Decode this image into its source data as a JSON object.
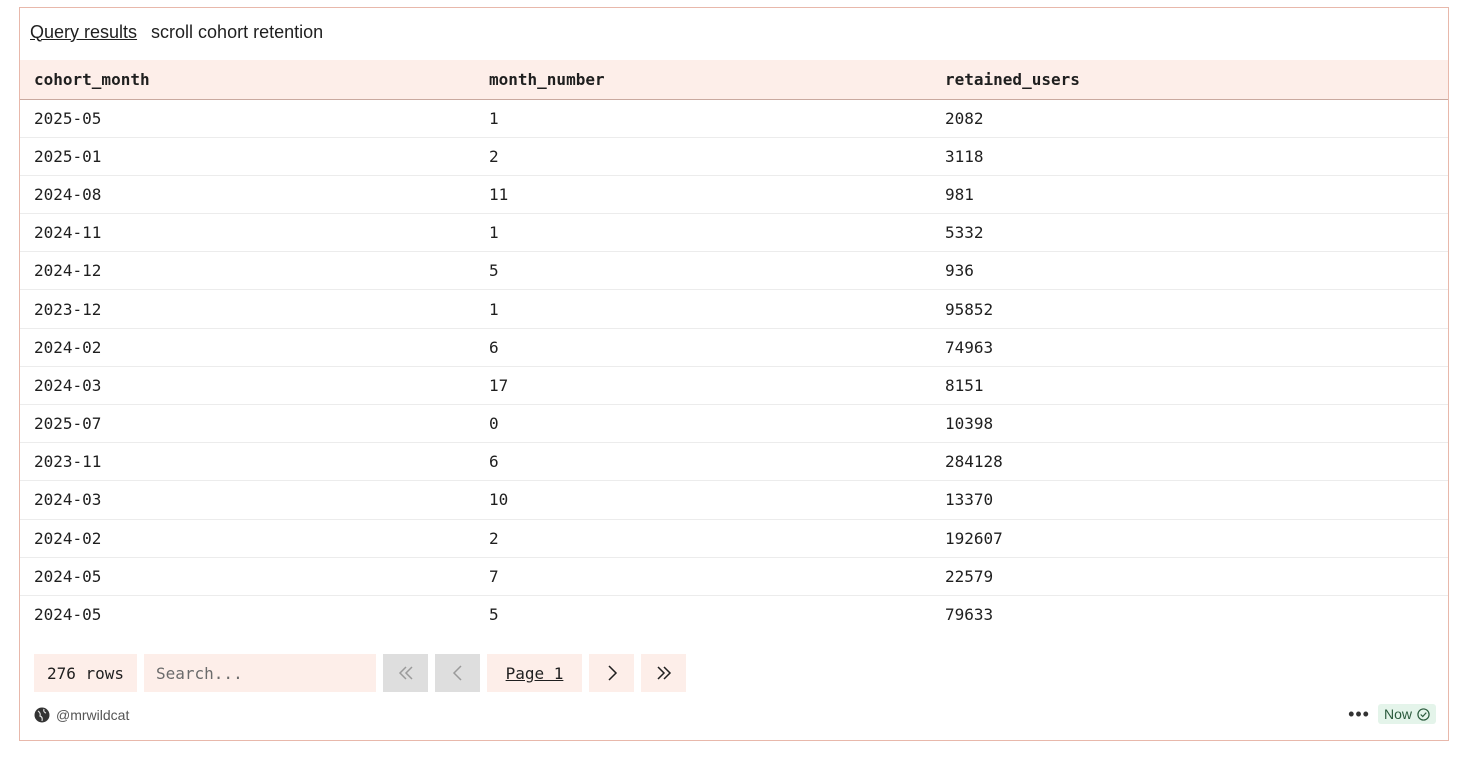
{
  "header": {
    "link_label": "Query results",
    "title": "scroll cohort retention"
  },
  "table": {
    "columns": [
      "cohort_month",
      "month_number",
      "retained_users"
    ],
    "rows": [
      [
        "2025-05",
        "1",
        "2082"
      ],
      [
        "2025-01",
        "2",
        "3118"
      ],
      [
        "2024-08",
        "11",
        "981"
      ],
      [
        "2024-11",
        "1",
        "5332"
      ],
      [
        "2024-12",
        "5",
        "936"
      ],
      [
        "2023-12",
        "1",
        "95852"
      ],
      [
        "2024-02",
        "6",
        "74963"
      ],
      [
        "2024-03",
        "17",
        "8151"
      ],
      [
        "2025-07",
        "0",
        "10398"
      ],
      [
        "2023-11",
        "6",
        "284128"
      ],
      [
        "2024-03",
        "10",
        "13370"
      ],
      [
        "2024-02",
        "2",
        "192607"
      ],
      [
        "2024-05",
        "7",
        "22579"
      ],
      [
        "2024-05",
        "5",
        "79633"
      ]
    ]
  },
  "pager": {
    "row_count": "276 rows",
    "search_placeholder": "Search...",
    "first_icon": "double-chevron-left-icon",
    "prev_icon": "chevron-left-icon",
    "page_label": "Page 1",
    "next_icon": "chevron-right-icon",
    "last_icon": "double-chevron-right-icon"
  },
  "footer": {
    "user": "@mrwildcat",
    "avatar_icon": "globe-icon",
    "more_icon": "ellipsis-icon",
    "status": "Now",
    "status_icon": "check-circle-icon"
  },
  "colors": {
    "accent_bg": "#fdeee9",
    "border": "#e8b8ab",
    "status_bg": "#e4f4ea"
  }
}
